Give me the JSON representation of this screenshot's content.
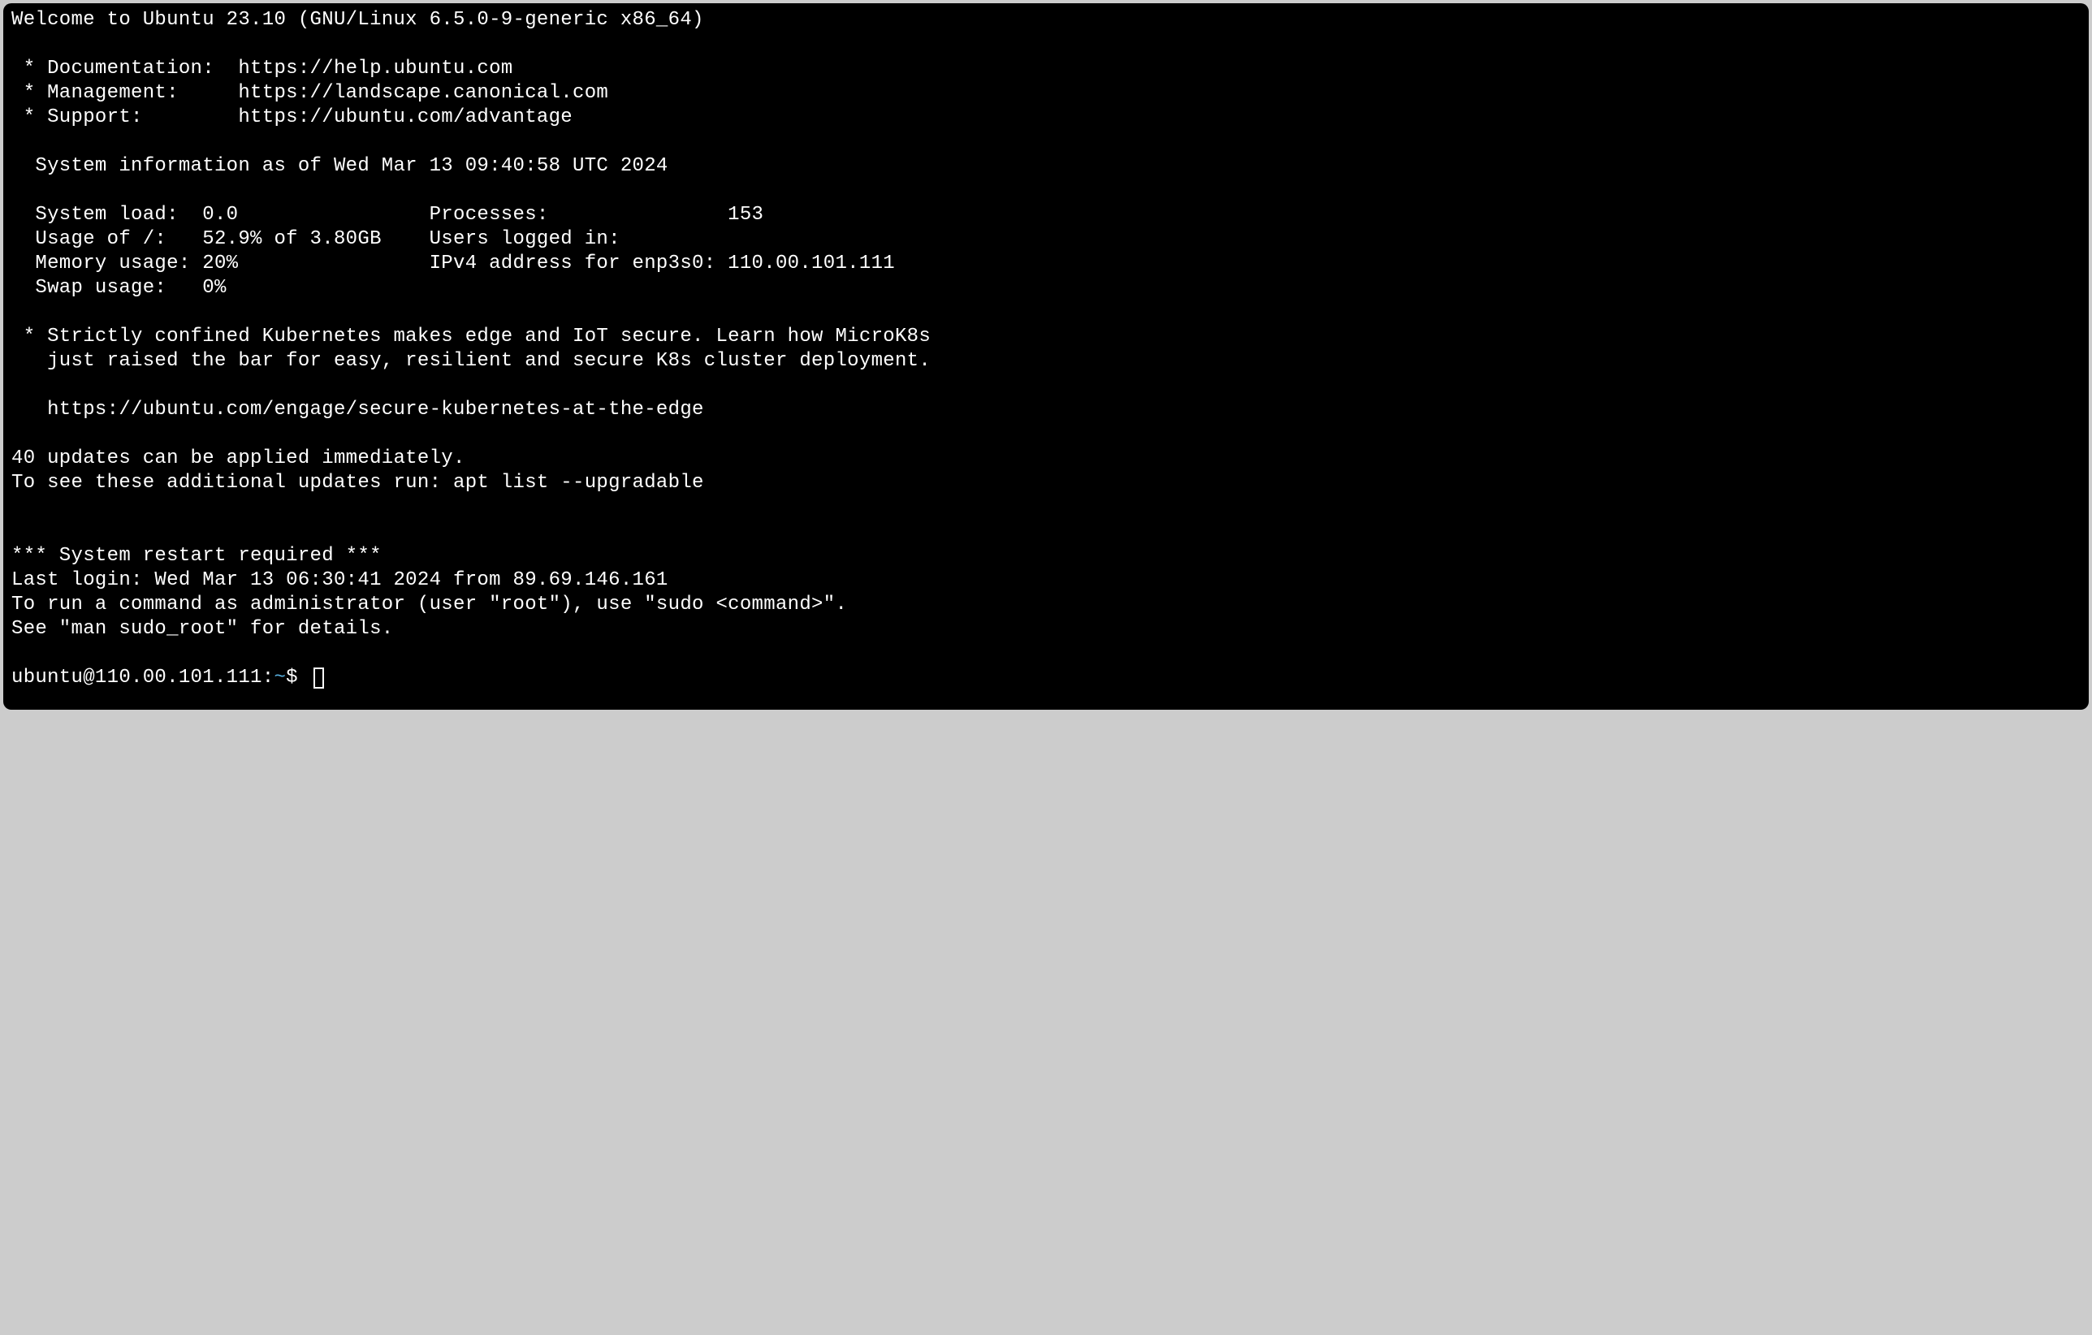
{
  "welcome": "Welcome to Ubuntu 23.10 (GNU/Linux 6.5.0-9-generic x86_64)",
  "links": {
    "doc": " * Documentation:  https://help.ubuntu.com",
    "mgmt": " * Management:     https://landscape.canonical.com",
    "support": " * Support:        https://ubuntu.com/advantage"
  },
  "sysinfo_header": "  System information as of Wed Mar 13 09:40:58 UTC 2024",
  "stats": {
    "row1": "  System load:  0.0                Processes:               153",
    "row2": "  Usage of /:   52.9% of 3.80GB    Users logged in:",
    "row3": "  Memory usage: 20%                IPv4 address for enp3s0: 110.00.101.111",
    "row4": "  Swap usage:   0%"
  },
  "promo": {
    "l1": " * Strictly confined Kubernetes makes edge and IoT secure. Learn how MicroK8s",
    "l2": "   just raised the bar for easy, resilient and secure K8s cluster deployment.",
    "l3": "   https://ubuntu.com/engage/secure-kubernetes-at-the-edge"
  },
  "updates": {
    "l1": "40 updates can be applied immediately.",
    "l2": "To see these additional updates run: apt list --upgradable"
  },
  "restart": "*** System restart required ***",
  "lastlogin": "Last login: Wed Mar 13 06:30:41 2024 from 89.69.146.161",
  "sudo": {
    "l1": "To run a command as administrator (user \"root\"), use \"sudo <command>\".",
    "l2": "See \"man sudo_root\" for details."
  },
  "prompt": {
    "user_host": "ubuntu@110.00.101.111:",
    "tilde": "~",
    "end": "$ "
  }
}
